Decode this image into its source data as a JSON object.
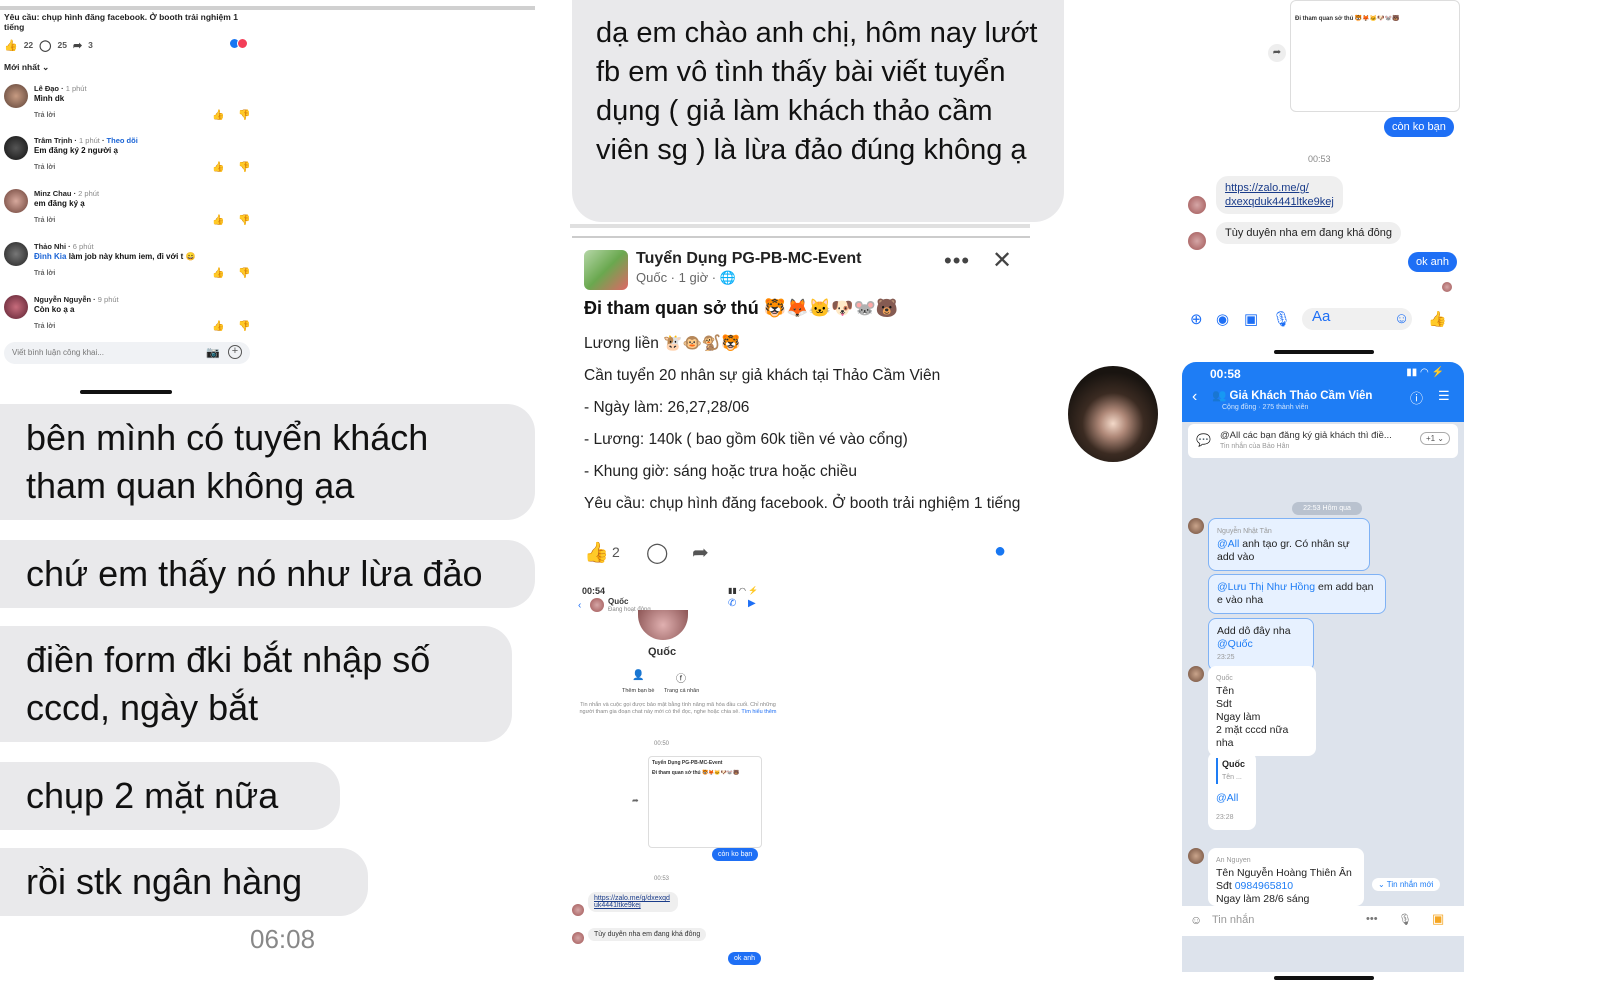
{
  "fb": {
    "requirement": "Yêu cầu: chụp hình đăng facebook. Ở booth trải nghiệm 1 tiếng",
    "likes": "22",
    "comments": "25",
    "shares": "3",
    "sort": "Mới nhất",
    "comments_list": [
      {
        "name": "Lê Đạo",
        "time": "1 phút",
        "follow": "",
        "tag": "",
        "text": "Mình dk",
        "reply": "Trả lời"
      },
      {
        "name": "Trâm Trịnh",
        "time": "1 phút",
        "follow": "Theo dõi",
        "tag": "",
        "text": "Em đăng ký 2 người ạ",
        "reply": "Trả lời"
      },
      {
        "name": "Minz Chau",
        "time": "2 phút",
        "follow": "",
        "tag": "",
        "text": "em đăng ký ạ",
        "reply": "Trả lời"
      },
      {
        "name": "Thảo Nhi",
        "time": "6 phút",
        "follow": "",
        "tag": "Đình Kia",
        "text": "làm job này khum iem, đi với t 😄",
        "reply": "Trả lời"
      },
      {
        "name": "Nguyễn Nguyễn",
        "time": "9 phút",
        "follow": "",
        "tag": "",
        "text": "Còn ko ạ a",
        "reply": "Trả lời"
      }
    ],
    "input_placeholder": "Viết bình luận công khai..."
  },
  "left_messages": [
    "bên mình có tuyển khách tham quan không ạa",
    "chứ em thấy nó như lừa đảo",
    "điền form đki bắt nhập số cccd, ngày bắt",
    "chụp 2 mặt nữa",
    "rồi stk ngân hàng"
  ],
  "left_time": "06:08",
  "mid": {
    "question": "dạ em chào anh chị, hôm nay lướt fb em vô tình thấy bài viết tuyển dụng ( giả làm khách thảo cầm viên sg ) là lừa đảo đúng không ạ",
    "post": {
      "page_name": "Tuyển Dụng PG-PB-MC-Event",
      "meta": "Quốc · 1 giờ · 🌐",
      "title": "Đi tham quan sở thú 🐯🦊🐱🐶🐭🐻",
      "lines": [
        "Lương liền 🐮🐵🐒🐯",
        "Cần tuyển 20 nhân sự giả khách tại Thảo Cầm Viên",
        "- Ngày làm: 26,27,28/06",
        "- Lương: 140k ( bao gồm 60k tiền vé vào cổng)",
        "- Khung giờ: sáng hoặc trưa hoặc chiều",
        "Yêu cầu: chụp hình đăng facebook. Ở booth trải nghiệm 1 tiếng"
      ],
      "likes": "2"
    },
    "mini": {
      "time": "00:54",
      "contact": "Quốc",
      "status": "Đang hoạt động",
      "name_big": "Quốc",
      "add_friend": "Thêm bạn bè",
      "profile": "Trang cá nhân",
      "notice": "Tin nhắn và cuộc gọi được bảo mật bằng tính năng mã hóa đầu cuối. Chỉ những người tham gia đoạn chat này mới có thể đọc, nghe hoặc chia sẻ.",
      "learn_more": "Tìm hiểu thêm",
      "t1": "00:50",
      "post_name": "Tuyển Dụng PG-PB-MC-Event",
      "post_title": "Đi tham quan sở thú 🐯🦊🐱🐶🐭🐻",
      "reply1": "còn ko bạn",
      "t2": "00:53",
      "link": "https://zalo.me/g/dxexqduk4441ltke9kej",
      "msg": "Tùy duyên nha em đang khá đông",
      "reply2": "ok anh"
    }
  },
  "right": {
    "card_title": "Đi tham quan sở thú 🐯🦊🐱🐶🐭🐻",
    "reply1": "còn ko bạn",
    "time": "00:53",
    "link_line1": "https://zalo.me/g/",
    "link_line2": "dxexqduk4441ltke9kej",
    "msg": "Tùy duyên nha em đang khá đông",
    "reply2": "ok anh",
    "aa": "Aa"
  },
  "zalo": {
    "time": "00:58",
    "group": "Giả Khách Thảo Cầm Viên",
    "members": "Cộng đồng · 275 thành viên",
    "pinned": "@All các bạn đăng ký giả khách thì điề...",
    "pinned_sub": "Tin nhắn của Bảo Hân",
    "pinned_count": "+1",
    "date": "22:53 Hôm qua",
    "m1_sender": "Nguyễn Nhật Tân",
    "m1_tag": "@All",
    "m1_text": "anh tạo gr. Có nhân sự add vào",
    "m2_tag": "@Lưu Thị Như Hồng",
    "m2_text": "em add bạn e vào nha",
    "m3_text": "Add dô đây nha",
    "m3_tag": "@Quốc",
    "m3_time": "23:25",
    "m4_sender": "Quốc",
    "m4_lines": [
      "Tên",
      "Sdt",
      "Ngay làm",
      "2 mặt cccd nữa nha"
    ],
    "m5_name": "Quốc",
    "m5_text": "Tên ...",
    "m5_tag": "@All",
    "m5_time": "23:28",
    "m6_sender": "An Nguyen",
    "m6_line1": "Tên Nguyễn Hoàng Thiên Ân",
    "m6_sdt_label": "Sđt",
    "m6_sdt": "0984965810",
    "m6_line3": "Ngay làm 28/6 sáng",
    "new_msg": "Tin nhắn mới",
    "input_placeholder": "Tin nhắn"
  },
  "colors": {
    "messenger_blue": "#1e6ff5",
    "zalo_blue": "#1e7df5",
    "bubble_gray": "#e9e9eb"
  }
}
